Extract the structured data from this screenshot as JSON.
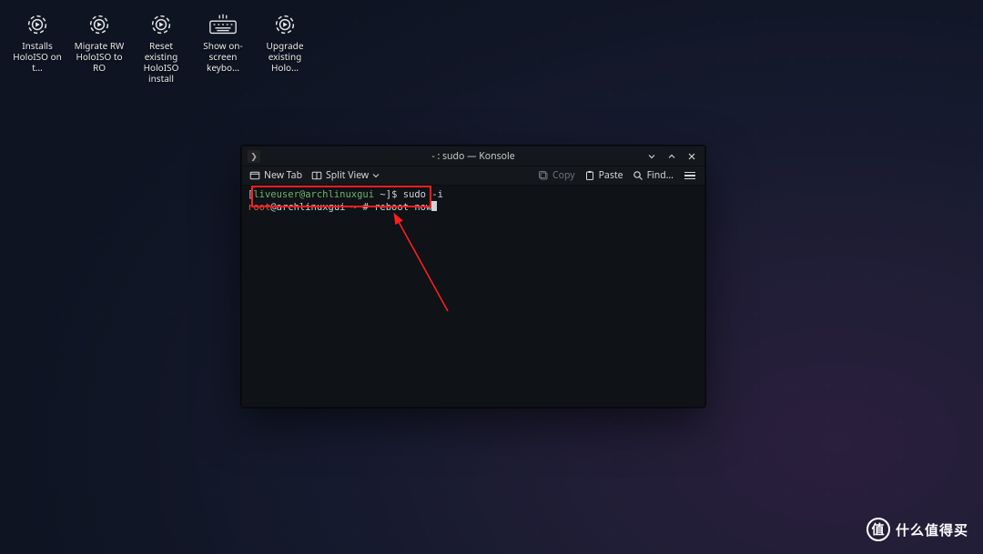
{
  "desktop": {
    "icons": [
      {
        "type": "gear",
        "label": "Installs HoloISO on t…"
      },
      {
        "type": "gear",
        "label": "Migrate RW HoloISO to RO"
      },
      {
        "type": "gear",
        "label": "Reset existing HoloISO install"
      },
      {
        "type": "keyboard",
        "label": "Show on-screen keybo…"
      },
      {
        "type": "gear",
        "label": "Upgrade existing Holo…"
      }
    ]
  },
  "window": {
    "title": "- : sudo — Konsole",
    "app_icon_glyph": "❯"
  },
  "toolbar": {
    "new_tab": "New Tab",
    "split_view": "Split View",
    "copy": "Copy",
    "paste": "Paste",
    "find": "Find…"
  },
  "terminal": {
    "line1": {
      "prompt_open": "[",
      "user": "liveuser@archlinuxgui",
      "path": " ~",
      "prompt_close": "]$ ",
      "cmd": "sudo -i"
    },
    "line2": {
      "user": "root",
      "at_host": "@archlinuxgui ~ # ",
      "cmd": "reboot now"
    }
  },
  "watermark": {
    "badge": "值",
    "text": "什么值得买"
  }
}
